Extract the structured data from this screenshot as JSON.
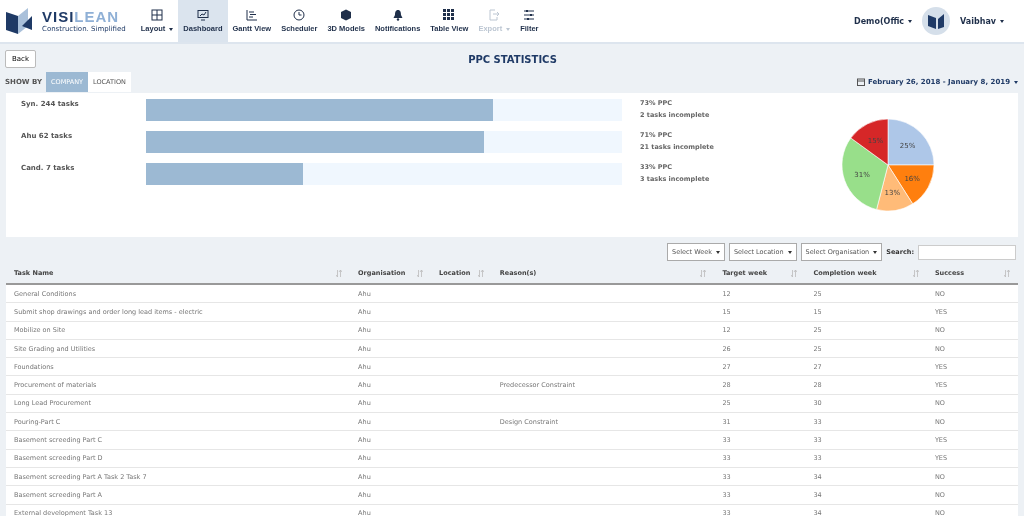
{
  "brand": {
    "name_dark": "VISI",
    "name_light": "LEAN",
    "tagline": "Construction. Simplified"
  },
  "nav": [
    {
      "label": "Layout",
      "dropdown": true,
      "selected": false,
      "disabled": false
    },
    {
      "label": "Dashboard",
      "dropdown": false,
      "selected": true,
      "disabled": false
    },
    {
      "label": "Gantt View",
      "dropdown": false,
      "selected": false,
      "disabled": false
    },
    {
      "label": "Scheduler",
      "dropdown": false,
      "selected": false,
      "disabled": false
    },
    {
      "label": "3D Models",
      "dropdown": false,
      "selected": false,
      "disabled": false
    },
    {
      "label": "Notifications",
      "dropdown": false,
      "selected": false,
      "disabled": false
    },
    {
      "label": "Table View",
      "dropdown": false,
      "selected": false,
      "disabled": false
    },
    {
      "label": "Export",
      "dropdown": true,
      "selected": false,
      "disabled": true
    },
    {
      "label": "Filter",
      "dropdown": false,
      "selected": false,
      "disabled": false
    }
  ],
  "project_menu": "Demo(Offic",
  "user_menu": "Vaibhav",
  "back_button": "Back",
  "page_title": "PPC STATISTICS",
  "show_by": {
    "label": "SHOW BY",
    "options": [
      {
        "label": "COMPANY",
        "selected": true
      },
      {
        "label": "LOCATION",
        "selected": false
      }
    ]
  },
  "date_range": "February 26, 2018 - January 8, 2019",
  "companies": [
    {
      "name": "Syn. 244 tasks",
      "level": 0.73,
      "ppc": "73% PPC",
      "incomplete": "2 tasks incomplete"
    },
    {
      "name": "Ahu 62 tasks",
      "level": 0.71,
      "ppc": "71% PPC",
      "incomplete": "21 tasks incomplete"
    },
    {
      "name": "Cand. 7 tasks",
      "level": 0.33,
      "ppc": "33% PPC",
      "incomplete": "3 tasks incomplete"
    }
  ],
  "pie": {
    "chart_data": {
      "type": "pie",
      "values": [
        25,
        16,
        13,
        31,
        15
      ],
      "colors": [
        "#aec7e8",
        "#ff7f0e",
        "#ffbb78",
        "#98df8a",
        "#d62728"
      ],
      "value_labels": [
        "25%",
        "16%",
        "13%",
        "31%",
        "15%"
      ]
    }
  },
  "filters": [
    "Select Week",
    "Select Location",
    "Select Organisation"
  ],
  "search_label": "Search:",
  "table": {
    "columns": [
      "Task Name",
      "Organisation",
      "Location",
      "Reason(s)",
      "Target week",
      "Completion week",
      "Success"
    ],
    "rows": [
      [
        "General Conditions",
        "Ahu",
        "",
        "",
        "12",
        "25",
        "NO"
      ],
      [
        "Submit shop drawings and order long lead items - electric",
        "Ahu",
        "",
        "",
        "15",
        "15",
        "YES"
      ],
      [
        "Mobilize on Site",
        "Ahu",
        "",
        "",
        "12",
        "25",
        "NO"
      ],
      [
        "Site Grading and Utilities",
        "Ahu",
        "",
        "",
        "26",
        "25",
        "NO"
      ],
      [
        "Foundations",
        "Ahu",
        "",
        "",
        "27",
        "27",
        "YES"
      ],
      [
        "Procurement of materials",
        "Ahu",
        "",
        "Predecessor Constraint",
        "28",
        "28",
        "YES"
      ],
      [
        "Long Lead Procurement",
        "Ahu",
        "",
        "",
        "25",
        "30",
        "NO"
      ],
      [
        "Pouring-Part C",
        "Ahu",
        "",
        "Design Constraint",
        "31",
        "33",
        "NO"
      ],
      [
        "Basement screeding Part C",
        "Ahu",
        "",
        "",
        "33",
        "33",
        "YES"
      ],
      [
        "Basement screeding Part D",
        "Ahu",
        "",
        "",
        "33",
        "33",
        "YES"
      ],
      [
        "Basement screeding Part A Task 2 Task 7",
        "Ahu",
        "",
        "",
        "33",
        "34",
        "NO"
      ],
      [
        "Basement screeding Part A",
        "Ahu",
        "",
        "",
        "33",
        "34",
        "NO"
      ],
      [
        "External development Task 13",
        "Ahu",
        "",
        "",
        "33",
        "34",
        "NO"
      ]
    ]
  }
}
